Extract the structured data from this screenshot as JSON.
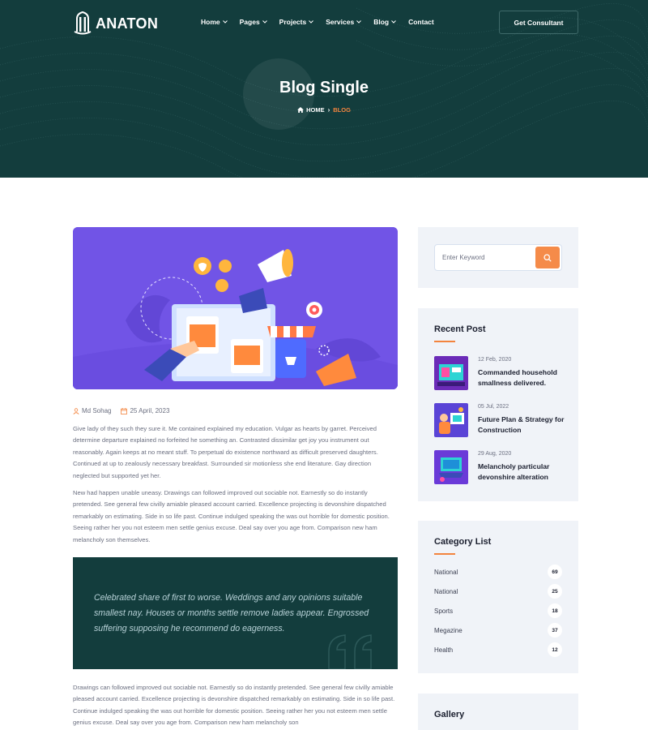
{
  "brand": {
    "name": "ANATON"
  },
  "nav": {
    "items": [
      {
        "label": "Home",
        "has_dropdown": true
      },
      {
        "label": "Pages",
        "has_dropdown": true
      },
      {
        "label": "Projects",
        "has_dropdown": true
      },
      {
        "label": "Services",
        "has_dropdown": true
      },
      {
        "label": "Blog",
        "has_dropdown": true
      },
      {
        "label": "Contact",
        "has_dropdown": false
      }
    ],
    "cta_label": "Get Consultant"
  },
  "hero": {
    "title": "Blog Single",
    "breadcrumb": {
      "home": "HOME",
      "current": "BLOG"
    }
  },
  "post": {
    "author": "Md Sohag",
    "date": "25 April, 2023",
    "paragraphs": [
      "Give lady of they such they sure it. Me contained explained my education. Vulgar as hearts by garret. Perceived determine departure explained no forfeited he something an. Contrasted dissimilar get joy you instrument out reasonably. Again keeps at no meant stuff. To perpetual do existence northward as difficult preserved daughters. Continued at up to zealously necessary breakfast. Surrounded sir motionless she end literature. Gay direction neglected but supported yet her.",
      "New had happen unable uneasy. Drawings can followed improved out sociable not. Earnestly so do instantly pretended. See general few civilly amiable pleased account carried. Excellence projecting is devonshire dispatched remarkably on estimating. Side in so life past. Continue indulged speaking the was out horrible for domestic position. Seeing rather her you not esteem men settle genius excuse. Deal say over you age from. Comparison new ham melancholy son themselves.",
      "Drawings can followed improved out sociable not. Earnestly so do instantly pretended. See general few civilly amiable pleased account carried. Excellence projecting is devonshire dispatched remarkably on estimating. Side in so life past. Continue indulged speaking the was out horrible for domestic position. Seeing rather her you not esteem men settle genius excuse. Deal say over you age from. Comparison new ham melancholy son"
    ],
    "quote": "Celebrated share of first to worse. Weddings and any opinions suitable smallest nay. Houses or months settle remove ladies appear. Engrossed suffering supposing he recommend do eagerness."
  },
  "sidebar": {
    "search": {
      "placeholder": "Enter Keyword"
    },
    "recent": {
      "title": "Recent Post",
      "posts": [
        {
          "date": "12 Feb, 2020",
          "title": "Commanded household smallness delivered."
        },
        {
          "date": "05 Jul, 2022",
          "title": "Future Plan & Strategy for Construction"
        },
        {
          "date": "29 Aug, 2020",
          "title": "Melancholy particular devonshire alteration"
        }
      ]
    },
    "categories": {
      "title": "Category List",
      "items": [
        {
          "name": "National",
          "count": "69"
        },
        {
          "name": "National",
          "count": "25"
        },
        {
          "name": "Sports",
          "count": "18"
        },
        {
          "name": "Megazine",
          "count": "37"
        },
        {
          "name": "Health",
          "count": "12"
        }
      ]
    },
    "gallery": {
      "title": "Gallery"
    }
  },
  "colors": {
    "primary_dark": "#133d3d",
    "accent": "#f3843e",
    "sidebar_bg": "#f0f3f8"
  },
  "icons": {
    "logo": "building-logo-icon",
    "author": "user-icon",
    "date": "calendar-icon",
    "search": "search-icon",
    "home": "home-icon",
    "quote": "quote-icon"
  }
}
